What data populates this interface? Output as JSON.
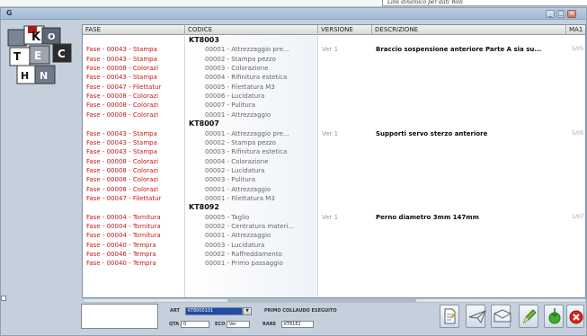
{
  "top_link": "Link dinamico per dati Web",
  "window": {
    "title": "G"
  },
  "logo": {
    "letters": [
      "K",
      "T",
      "E",
      "C",
      "H",
      "N",
      "O"
    ]
  },
  "columns": {
    "fasi": "FASE",
    "codice": "CODICE",
    "versione": "VERSIONE",
    "descrizione": "DESCRIZIONE",
    "mat": "MA1"
  },
  "groups": [
    {
      "code": "KT8003",
      "version": "Ver 1",
      "description": "Braccio sospensione anteriore Parte A sia su...",
      "mat": "5/05",
      "rows": [
        {
          "fase": "Fase - 00043 - Stampa",
          "sub": "00001 - Attrezzaggio pre..."
        },
        {
          "fase": "Fase - 00043 - Stampa",
          "sub": "00002 - Stampa pezzo"
        },
        {
          "fase": "Fase - 00008 - Colorazi",
          "sub": "00003 - Colorazione"
        },
        {
          "fase": "Fase - 00043 - Stampa",
          "sub": "00004 - Rifinitura estetica"
        },
        {
          "fase": "Fase - 00047 - Filettatur",
          "sub": "00005 - Filettatura M3"
        },
        {
          "fase": "Fase - 00008 - Colorazi",
          "sub": "00006 - Lucidatura"
        },
        {
          "fase": "Fase - 00008 - Colorazi",
          "sub": "00007 - Pulitura"
        },
        {
          "fase": "Fase - 00008 - Colorazi",
          "sub": "00001 - Attrezzaggio"
        }
      ]
    },
    {
      "code": "KT8007",
      "version": "Ver 1",
      "description": "Supporti servo sterzo anteriore",
      "mat": "5/05",
      "rows": [
        {
          "fase": "Fase - 00043 - Stampa",
          "sub": "00001 - Attrezzaggio pre..."
        },
        {
          "fase": "Fase - 00043 - Stampa",
          "sub": "00002 - Stampa pezzo"
        },
        {
          "fase": "Fase - 00043 - Stampa",
          "sub": "00003 - Rifinitura estetica"
        },
        {
          "fase": "Fase - 00008 - Colorazi",
          "sub": "00004 - Colorazione"
        },
        {
          "fase": "Fase - 00008 - Colorazi",
          "sub": "00002 - Lucidatura"
        },
        {
          "fase": "Fase - 00008 - Colorazi",
          "sub": "00003 - Pulitura"
        },
        {
          "fase": "Fase - 00008 - Colorazi",
          "sub": "00001 - Attrezzaggio"
        },
        {
          "fase": "Fase - 00047 - Filettatur",
          "sub": "00001 - Filettatura M3"
        }
      ]
    },
    {
      "code": "KT8092",
      "version": "Ver 1",
      "description": "Perno diametro 3mm 147mm",
      "mat": "1/07",
      "rows": [
        {
          "fase": "Fase - 00004 - Tornitura",
          "sub": "00005 - Taglio"
        },
        {
          "fase": "Fase - 00004 - Tornitura",
          "sub": "00002 - Centratura materi..."
        },
        {
          "fase": "Fase - 00004 - Tornitura",
          "sub": "00001 - Attrezzaggio"
        },
        {
          "fase": "Fase - 00040 - Tempra",
          "sub": "00003 - Lucidatura"
        },
        {
          "fase": "Fase - 00046 - Tempra",
          "sub": "00002 - Raffreddamento"
        },
        {
          "fase": "Fase - 00040 - Tempra",
          "sub": "00001 - Primo passaggio"
        }
      ]
    }
  ],
  "form": {
    "cod_label": "ART",
    "cod_value": "KT8000101",
    "check_label": "PRIMO COLLAUDO ESEGUITO",
    "qta_label": "QTA",
    "qta_value": "0",
    "eco_label": "ECO",
    "eco_value": "Ver",
    "rare_label": "RARE",
    "rare_value": "KT8182"
  },
  "colors": {
    "fase_text": "#c41818",
    "code_text": "#0a0a0a",
    "window_bg": "#c5d0dc",
    "selected_field": "#1e4ba8"
  }
}
